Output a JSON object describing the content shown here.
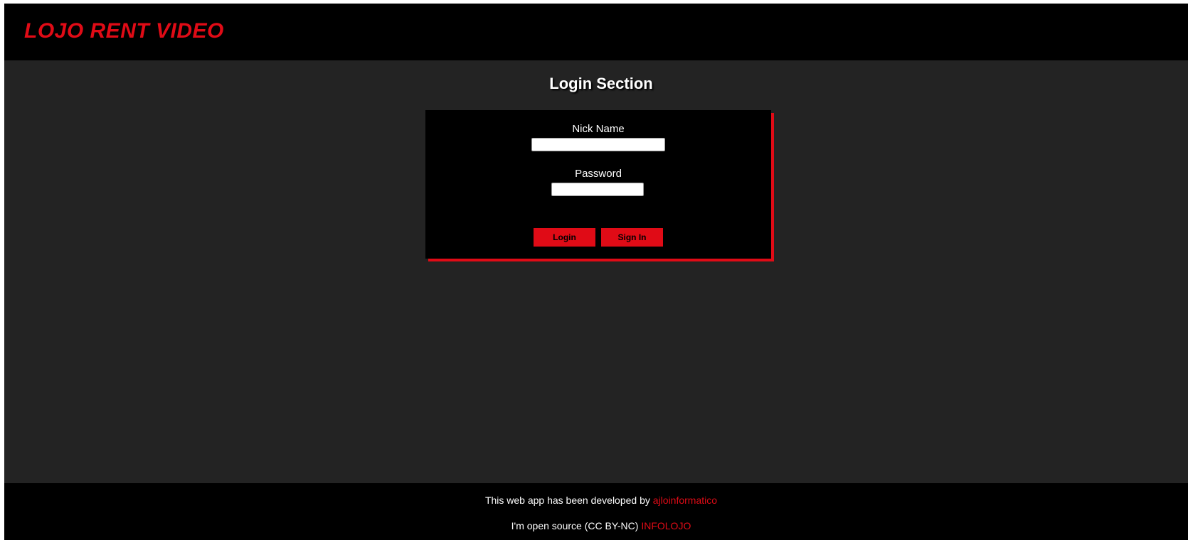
{
  "header": {
    "brand": "LOJO RENT VIDEO"
  },
  "main": {
    "title": "Login Section",
    "form": {
      "nickname_label": "Nick Name",
      "nickname_value": "",
      "password_label": "Password",
      "password_value": "",
      "login_label": "Login",
      "signin_label": "Sign In"
    }
  },
  "footer": {
    "developed_text": "This web app has been developed by",
    "developer_link": "ajloinformatico",
    "license_text": "I'm open source (CC BY-NC)",
    "license_link": "INFOLOJO"
  },
  "colors": {
    "accent": "#e00b16",
    "background": "#232323",
    "bars": "#000000",
    "text": "#ffffff"
  }
}
